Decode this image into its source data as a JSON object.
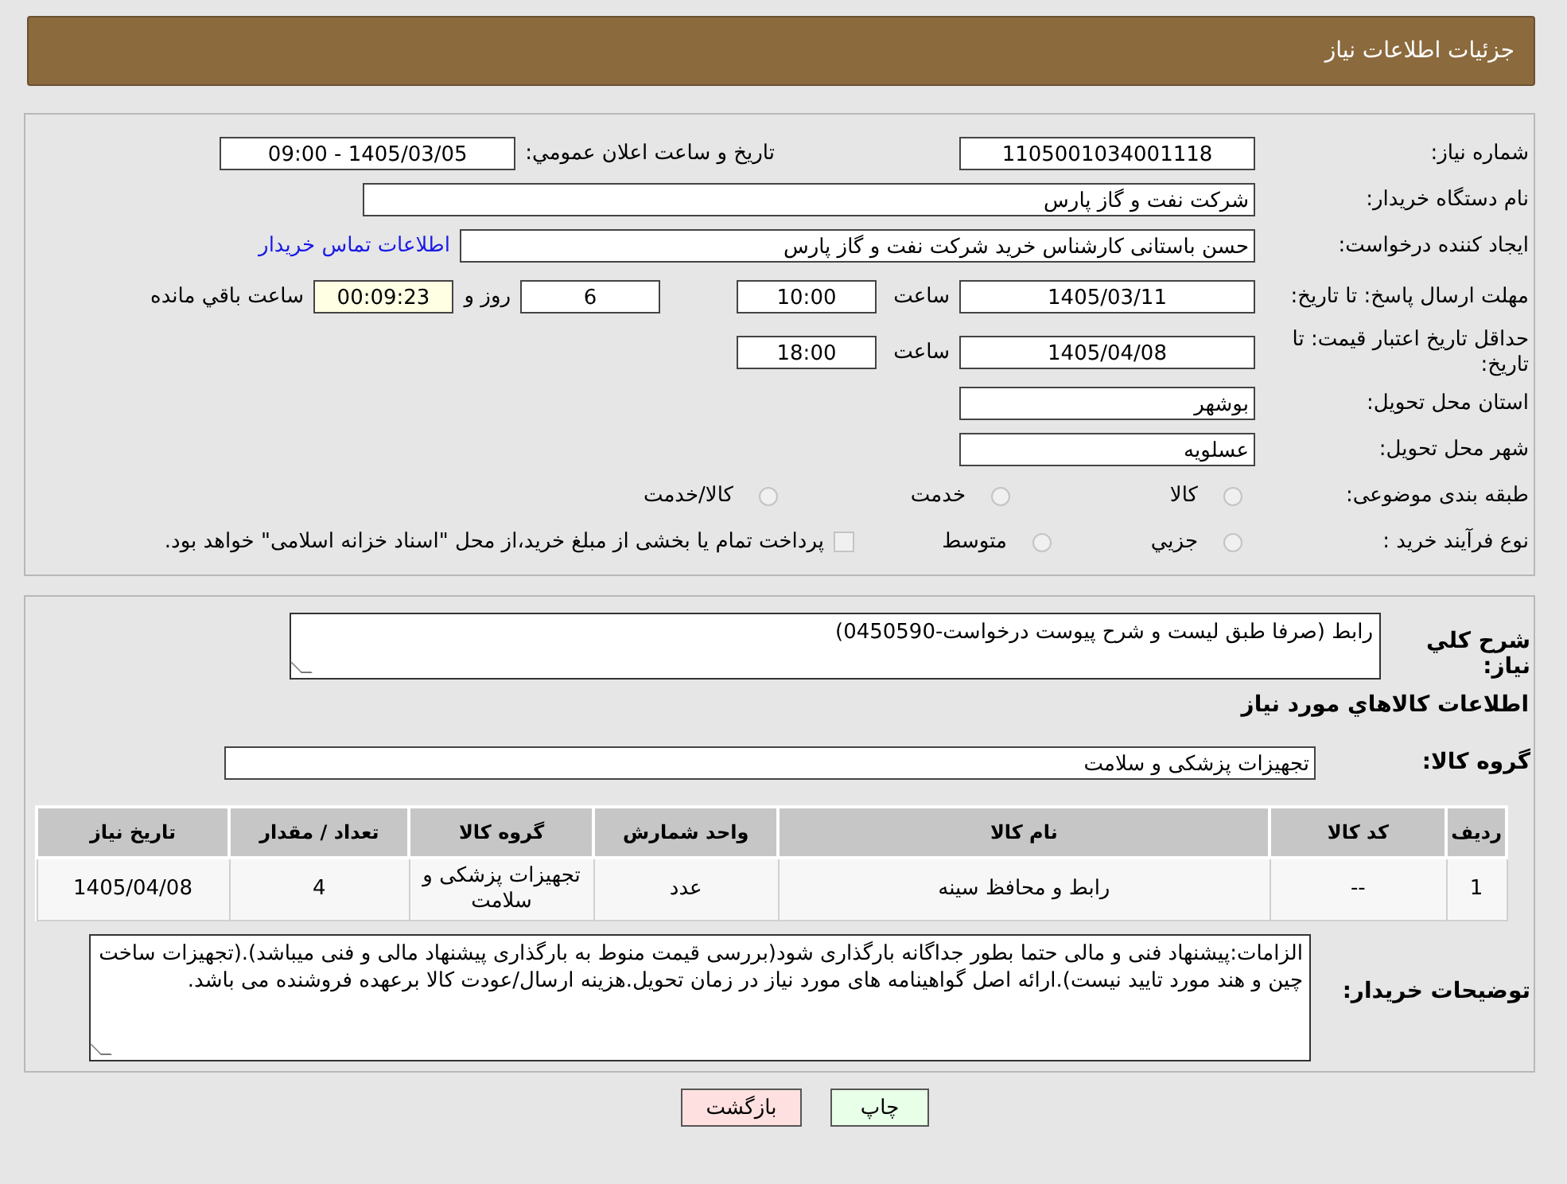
{
  "header": {
    "title": "جزئیات اطلاعات نیاز"
  },
  "details": {
    "need_number_label": "شماره نیاز:",
    "need_number": "1105001034001118",
    "announce_label": "تاریخ و ساعت اعلان عمومي:",
    "announce_value": "1405/03/05 - 09:00",
    "buyer_label": "نام دستگاه خریدار:",
    "buyer": "شرکت نفت و گاز پارس",
    "creator_label": "ایجاد کننده درخواست:",
    "creator": "حسن باستانی کارشناس خرید شرکت نفت و گاز پارس",
    "contact_link": "اطلاعات تماس خریدار",
    "deadline_label": "مهلت ارسال پاسخ: تا تاریخ:",
    "deadline_date": "1405/03/11",
    "deadline_time_label": "ساعت",
    "deadline_time": "10:00",
    "days": "6",
    "days_label": "روز و",
    "remaining": "00:09:23",
    "remaining_label": "ساعت باقي مانده",
    "validity_label": "حداقل تاریخ اعتبار قیمت: تا تاریخ:",
    "validity_date": "1405/04/08",
    "validity_time_label": "ساعت",
    "validity_time": "18:00",
    "province_label": "استان محل تحویل:",
    "province": "بوشهر",
    "city_label": "شهر محل تحویل:",
    "city": "عسلویه",
    "category_label": "طبقه بندی موضوعی:",
    "categories": [
      {
        "label": "کالا",
        "selected": false
      },
      {
        "label": "خدمت",
        "selected": false
      },
      {
        "label": "کالا/خدمت",
        "selected": false
      }
    ],
    "process_label": "نوع فرآیند خرید :",
    "processes": [
      {
        "label": "جزيي",
        "selected": false
      },
      {
        "label": "متوسط",
        "selected": false
      }
    ],
    "payment": {
      "label": "پرداخت تمام یا بخشی از مبلغ خرید،از محل \"اسناد خزانه اسلامی\" خواهد بود.",
      "checked": false
    }
  },
  "summary": {
    "description_label": "شرح کلي نیاز:",
    "description": "رابط (صرفا طبق لیست و شرح پیوست درخواست-0450590)",
    "goods_title": "اطلاعات کالاهاي مورد نیاز",
    "group_label": "گروه کالا:",
    "group": "تجهیزات پزشکی و سلامت",
    "table": {
      "columns": [
        "ردیف",
        "کد کالا",
        "نام کالا",
        "واحد شمارش",
        "گروه کالا",
        "تعداد / مقدار",
        "تاریخ نیاز"
      ],
      "rows": [
        [
          "1",
          "--",
          "رابط و محافظ سینه",
          "عدد",
          "تجهیزات پزشکی و سلامت",
          "4",
          "1405/04/08"
        ]
      ]
    },
    "notes_label": "توضیحات خریدار:",
    "notes": "الزامات:پیشنهاد فنی و مالی حتما  بطور جداگانه بارگذاری شود(بررسی قیمت منوط به بارگذاری پیشنهاد مالی و فنی میباشد).(تجهیزات ساخت چین و هند مورد تایید نیست).ارائه اصل گواهینامه های مورد نیاز در زمان تحویل.هزینه ارسال/عودت کالا برعهده فروشنده می باشد."
  },
  "buttons": [
    {
      "kind": "print",
      "label": "چاپ"
    },
    {
      "kind": "back",
      "label": "بازگشت"
    }
  ]
}
